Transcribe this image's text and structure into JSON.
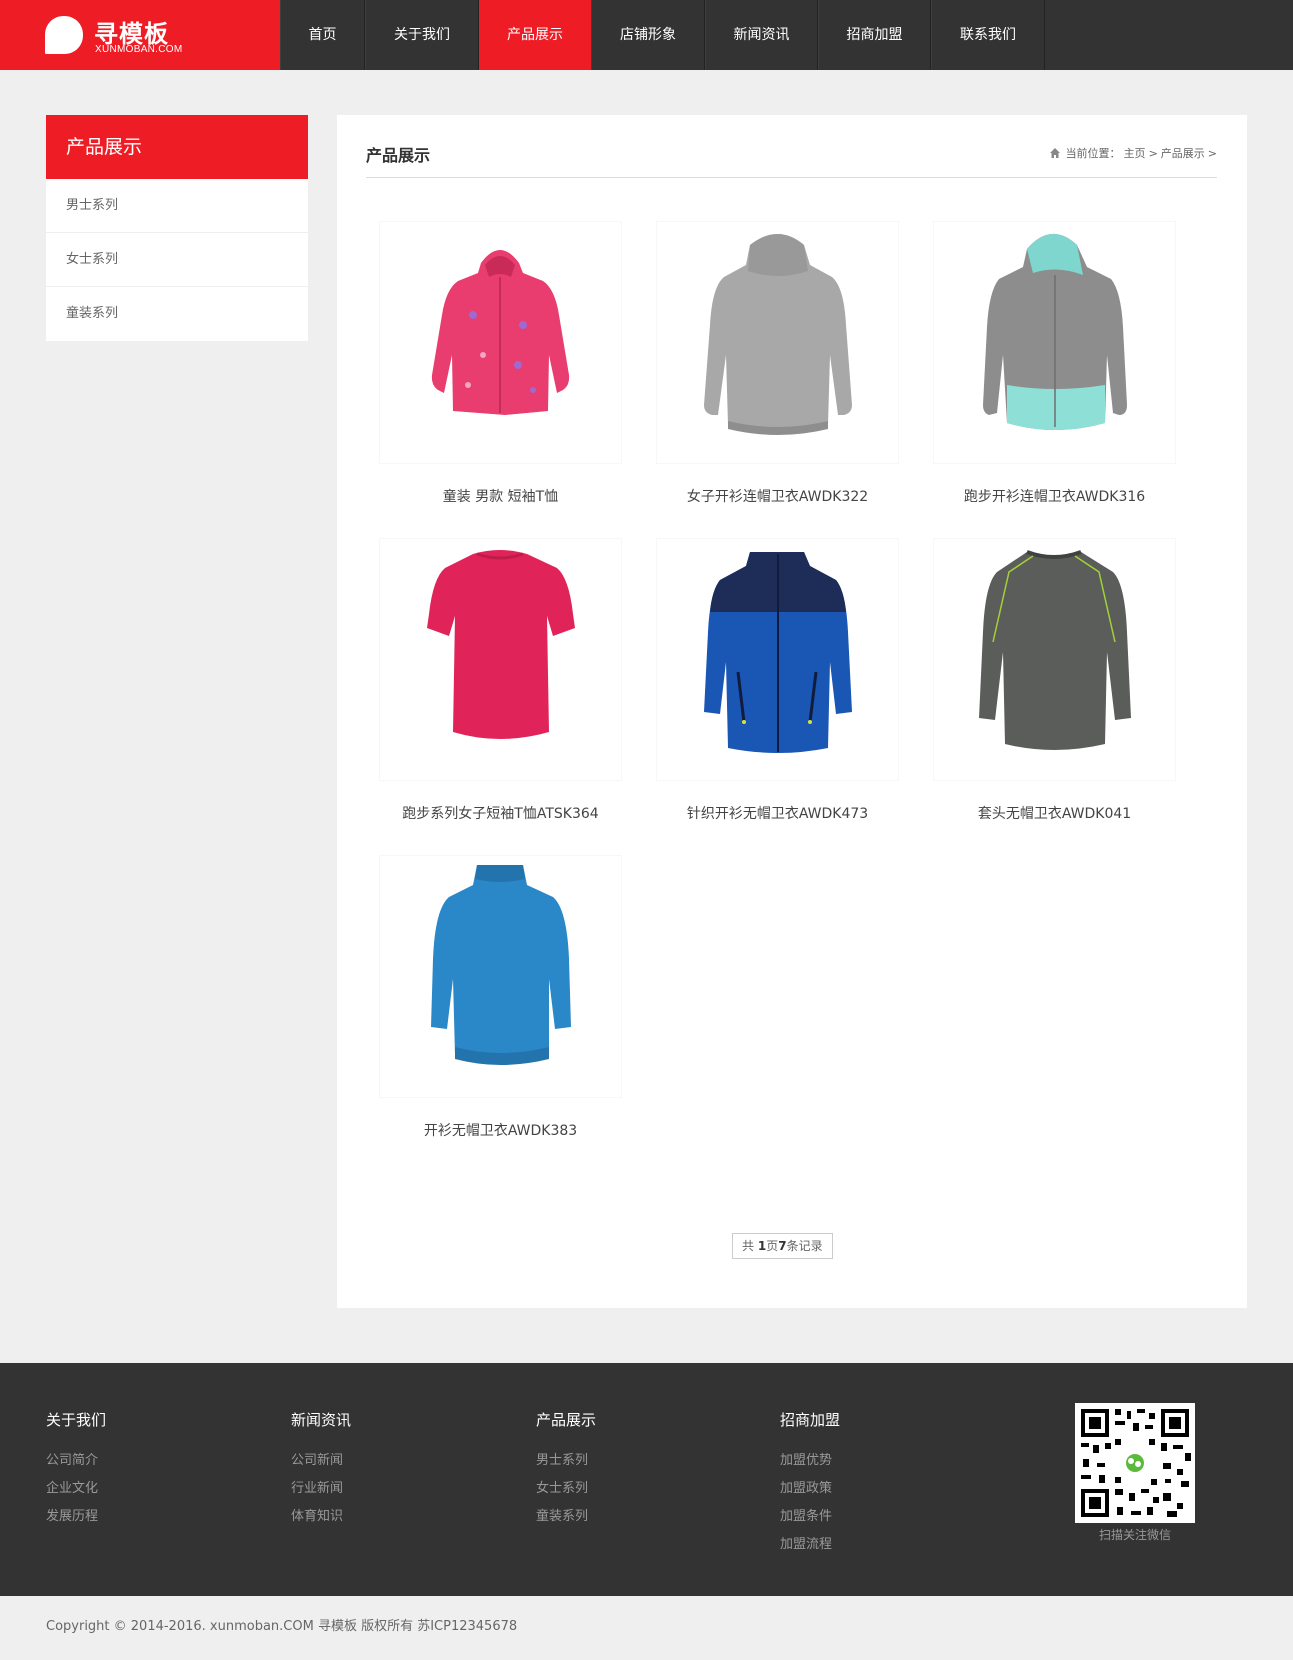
{
  "header": {
    "logo_title": "寻模板",
    "logo_sub": "XUNMOBAN.COM",
    "brand_color": "#ee1c25",
    "nav": [
      {
        "label": "首页",
        "active": false
      },
      {
        "label": "关于我们",
        "active": false
      },
      {
        "label": "产品展示",
        "active": true
      },
      {
        "label": "店铺形象",
        "active": false
      },
      {
        "label": "新闻资讯",
        "active": false
      },
      {
        "label": "招商加盟",
        "active": false
      },
      {
        "label": "联系我们",
        "active": false
      }
    ]
  },
  "sidebar": {
    "title": "产品展示",
    "items": [
      {
        "label": "男士系列"
      },
      {
        "label": "女士系列"
      },
      {
        "label": "童装系列"
      }
    ]
  },
  "main": {
    "title": "产品展示",
    "breadcrumb": {
      "prefix": "当前位置：",
      "home": "主页",
      "sep1": ">",
      "current": "产品展示",
      "sep2": ">"
    },
    "products": [
      {
        "name": "童装 男款 短袖T恤",
        "image": "pink-hoodie"
      },
      {
        "name": "女子开衫连帽卫衣AWDK322",
        "image": "grey-hoodie"
      },
      {
        "name": "跑步开衫连帽卫衣AWDK316",
        "image": "grey-teal-hoodie"
      },
      {
        "name": "跑步系列女子短袖T恤ATSK364",
        "image": "pink-tshirt"
      },
      {
        "name": "针织开衫无帽卫衣AWDK473",
        "image": "blue-navy-jacket"
      },
      {
        "name": "套头无帽卫衣AWDK041",
        "image": "dark-grey-sweatshirt"
      },
      {
        "name": "开衫无帽卫衣AWDK383",
        "image": "blue-jacket"
      }
    ],
    "pager": {
      "pre": "共",
      "pages": "1",
      "mid": "页",
      "records": "7",
      "post": "条记录"
    }
  },
  "footer": {
    "columns": [
      {
        "title": "关于我们",
        "links": [
          "公司简介",
          "企业文化",
          "发展历程"
        ]
      },
      {
        "title": "新闻资讯",
        "links": [
          "公司新闻",
          "行业新闻",
          "体育知识"
        ]
      },
      {
        "title": "产品展示",
        "links": [
          "男士系列",
          "女士系列",
          "童装系列"
        ]
      },
      {
        "title": "招商加盟",
        "links": [
          "加盟优势",
          "加盟政策",
          "加盟条件",
          "加盟流程"
        ]
      }
    ],
    "qr_caption": "扫描关注微信",
    "copyright": "Copyright © 2014-2016. xunmoban.COM 寻模板 版权所有    苏ICP12345678"
  }
}
